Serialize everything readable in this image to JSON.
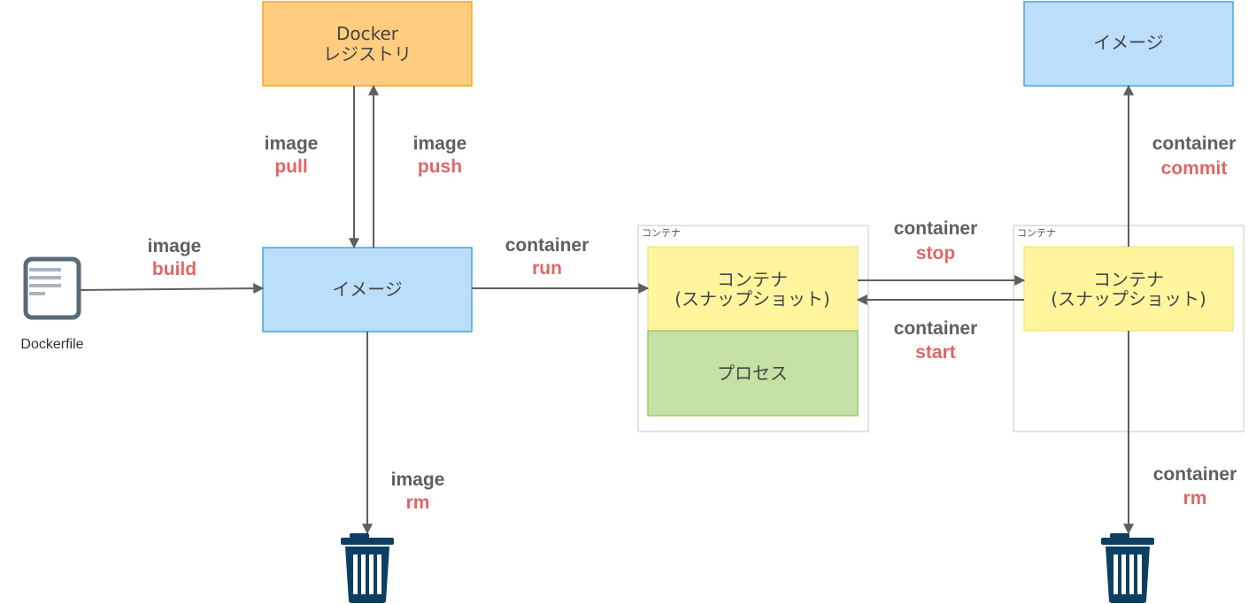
{
  "nodes": {
    "registry": {
      "line1": "Docker",
      "line2": "レジストリ"
    },
    "image_main": {
      "label": "イメージ"
    },
    "image_commit": {
      "label": "イメージ"
    },
    "container_group_1": {
      "title": "コンテナ"
    },
    "container_group_2": {
      "title": "コンテナ"
    },
    "snapshot_1": {
      "line1": "コンテナ",
      "line2": "(スナップショット)"
    },
    "snapshot_2": {
      "line1": "コンテナ",
      "line2": "(スナップショット)"
    },
    "process": {
      "label": "プロセス"
    },
    "dockerfile": {
      "label": "Dockerfile"
    }
  },
  "edges": {
    "pull": {
      "group": "image",
      "command": "pull"
    },
    "push": {
      "group": "image",
      "command": "push"
    },
    "build": {
      "group": "image",
      "command": "build"
    },
    "run": {
      "group": "container",
      "command": "run"
    },
    "image_rm": {
      "group": "image",
      "command": "rm"
    },
    "stop": {
      "group": "container",
      "command": "stop"
    },
    "start": {
      "group": "container",
      "command": "start"
    },
    "commit": {
      "group": "container",
      "command": "commit"
    },
    "container_rm": {
      "group": "container",
      "command": "rm"
    }
  },
  "icons": {
    "dockerfile": "document-icon",
    "trash_left": "trash-icon",
    "trash_right": "trash-icon"
  },
  "colors": {
    "registry_fill": "#ffcc80",
    "registry_stroke": "#f5a623",
    "image_fill": "#bbdefb",
    "image_stroke": "#4aa3df",
    "snapshot_fill": "#fff59d",
    "snapshot_stroke": "#f3e58b",
    "process_fill": "#c5e1a5",
    "process_stroke": "#9ccc65",
    "edge": "#5f5f5f",
    "command_group": "#5f5f5f",
    "command_name": "#e06666",
    "trash": "#0d3f63"
  }
}
